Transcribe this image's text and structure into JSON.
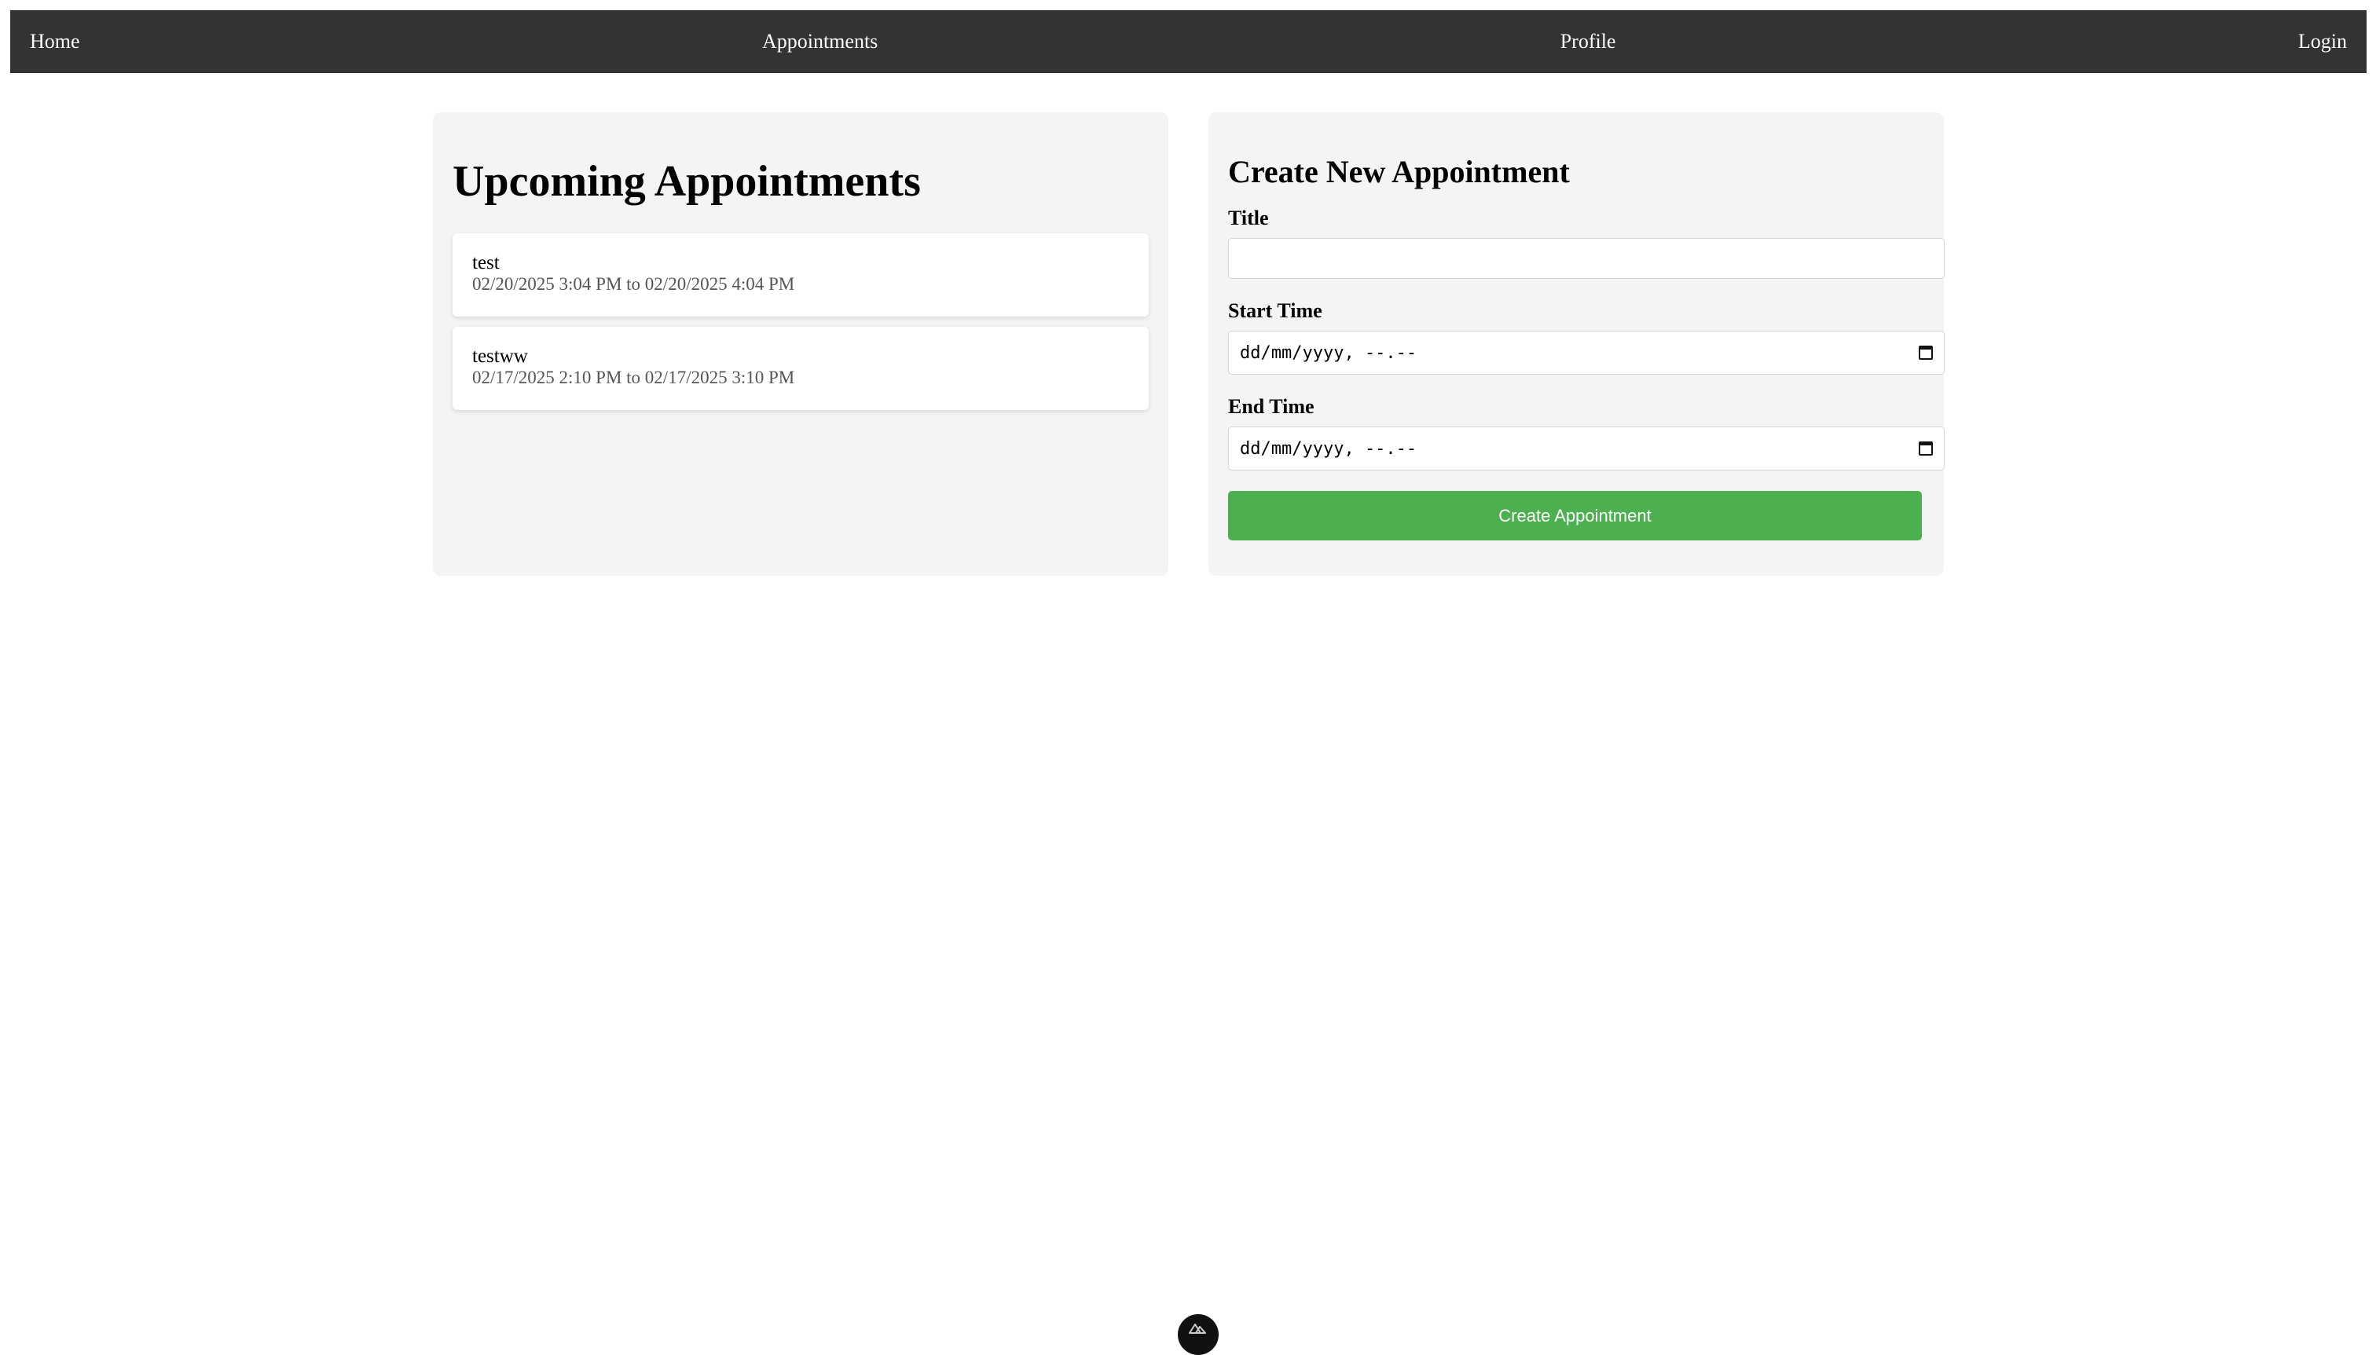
{
  "nav": {
    "home": "Home",
    "appointments": "Appointments",
    "profile": "Profile",
    "login": "Login"
  },
  "upcoming": {
    "heading": "Upcoming Appointments",
    "items": [
      {
        "title": "test",
        "time": "02/20/2025 3:04 PM to 02/20/2025 4:04 PM"
      },
      {
        "title": "testww",
        "time": "02/17/2025 2:10 PM to 02/17/2025 3:10 PM"
      }
    ]
  },
  "form": {
    "heading": "Create New Appointment",
    "title_label": "Title",
    "title_value": "",
    "start_label": "Start Time",
    "start_placeholder": "dd/mm/yyyy, --.--",
    "end_label": "End Time",
    "end_placeholder": "dd/mm/yyyy, --.--",
    "submit_label": "Create Appointment"
  },
  "colors": {
    "navbar": "#333333",
    "panel": "#f4f4f4",
    "button": "#4caf50"
  },
  "icons": [
    "calendar-icon",
    "nuxt-devtools-icon"
  ]
}
